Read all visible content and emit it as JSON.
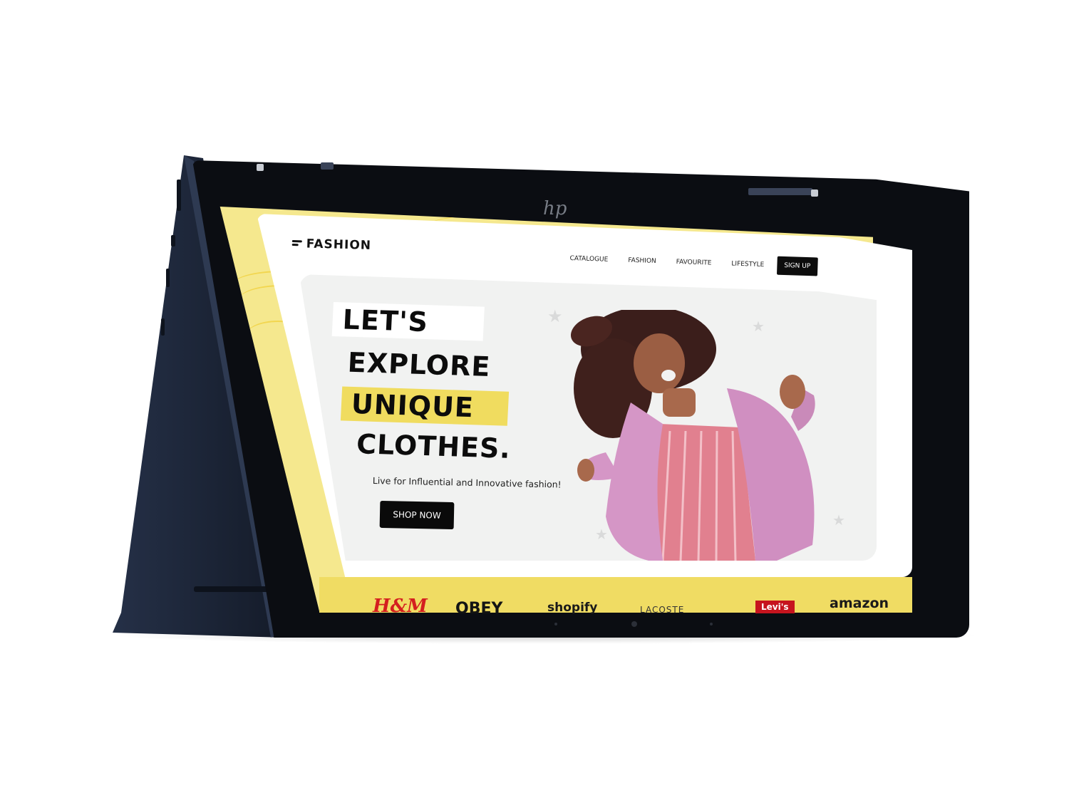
{
  "site": {
    "brand_name": "FASHION",
    "nav": {
      "items": [
        "CATALOGUE",
        "FASHION",
        "FAVOURITE",
        "LIFESTYLE"
      ],
      "signup_label": "SIGN UP"
    },
    "hero": {
      "headline_lines": [
        "LET'S",
        "EXPLORE",
        "UNIQUE",
        "CLOTHES."
      ],
      "tagline": "Live for Influential and Innovative fashion!",
      "cta_label": "SHOP NOW"
    },
    "partner_brands": [
      "H&M",
      "OBEY",
      "shopify",
      "LACOSTE",
      "Levi's",
      "amazon"
    ]
  },
  "device": {
    "logo_glyph": "hp"
  },
  "colors": {
    "accent_yellow": "#f0dc5f",
    "band_yellow": "#f5e88e",
    "device_body": "#1a2233",
    "button_black": "#0a0a0a"
  },
  "icons": [
    "brand-mark-icon",
    "star-icon"
  ]
}
